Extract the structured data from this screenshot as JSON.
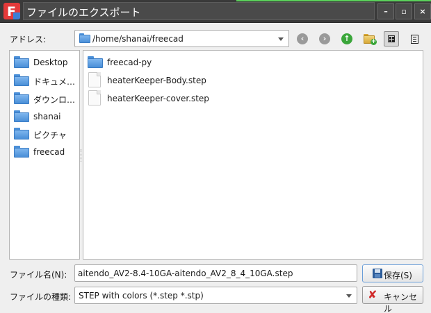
{
  "window": {
    "title": "ファイルのエクスポート",
    "minimize_glyph": "–",
    "maximize_glyph": "▫",
    "close_glyph": "×"
  },
  "address": {
    "label": "アドレス:",
    "path": "/home/shanai/freecad"
  },
  "toolbar": {
    "back_glyph": "‹",
    "forward_glyph": "›",
    "up_glyph": "↑",
    "new_folder_glyph": "+"
  },
  "sidebar": {
    "items": [
      {
        "label": "Desktop"
      },
      {
        "label": "ドキュメ…"
      },
      {
        "label": "ダウンロ…"
      },
      {
        "label": "shanai"
      },
      {
        "label": "ピクチャ"
      },
      {
        "label": "freecad"
      }
    ]
  },
  "files": [
    {
      "label": "freecad-py",
      "kind": "folder"
    },
    {
      "label": "heaterKeeper-Body.step",
      "kind": "file"
    },
    {
      "label": "heaterKeeper-cover.step",
      "kind": "file"
    }
  ],
  "filename": {
    "label": "ファイル名(N):",
    "value": "aitendo_AV2-8.4-10GA-aitendo_AV2_8_4_10GA.step"
  },
  "filetype": {
    "label": "ファイルの種類:",
    "value": "STEP with colors (*.step *.stp)"
  },
  "buttons": {
    "save": "保存(S)",
    "cancel": "キャンセル"
  },
  "icons": {
    "app": "freecad-icon",
    "folder": "folder-icon",
    "file": "file-icon"
  }
}
